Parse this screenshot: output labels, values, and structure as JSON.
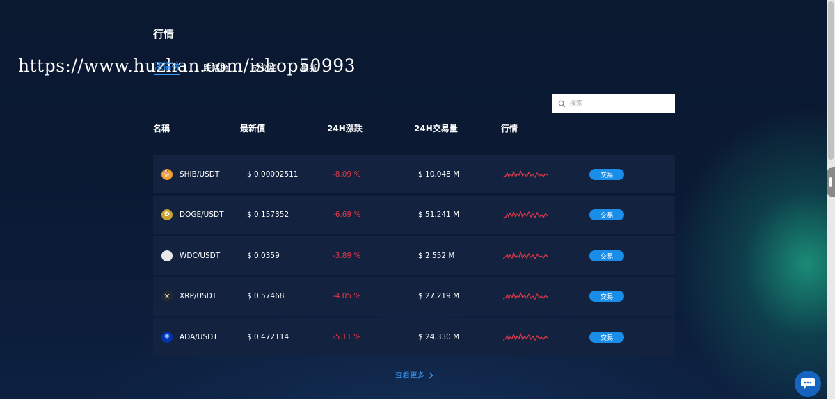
{
  "section": {
    "title": "行情"
  },
  "tabs": [
    {
      "label": "漲幅榜",
      "active": true
    },
    {
      "label": "跌幅榜",
      "active": false
    },
    {
      "label": "成交額",
      "active": false
    },
    {
      "label": "最新",
      "active": false
    }
  ],
  "watermark": "https://www.huzhan.com/ishop50993",
  "search": {
    "placeholder": "搜索",
    "icon": "search-icon"
  },
  "columns": {
    "name": "名稱",
    "price": "最新價",
    "change": "24H漲跌",
    "volume": "24H交易量",
    "trend": "行情"
  },
  "rows": [
    {
      "pair": "SHIB/USDT",
      "price": "$ 0.00002511",
      "change": "-8.09 %",
      "volume": "$ 10.048 M",
      "action": "交易",
      "icon": "shib-icon",
      "icon_color": "#f0a030"
    },
    {
      "pair": "DOGE/USDT",
      "price": "$ 0.157352",
      "change": "-6.69 %",
      "volume": "$ 51.241 M",
      "action": "交易",
      "icon": "doge-icon",
      "icon_color": "#c9a232"
    },
    {
      "pair": "WDC/USDT",
      "price": "$ 0.0359",
      "change": "-3.89 %",
      "volume": "$ 2.552 M",
      "action": "交易",
      "icon": "wdc-icon",
      "icon_color": "#e8e8e8"
    },
    {
      "pair": "XRP/USDT",
      "price": "$ 0.57468",
      "change": "-4.05 %",
      "volume": "$ 27.219 M",
      "action": "交易",
      "icon": "xrp-icon",
      "icon_color": "#23292f"
    },
    {
      "pair": "ADA/USDT",
      "price": "$ 0.472114",
      "change": "-5.11 %",
      "volume": "$ 24.330 M",
      "action": "交易",
      "icon": "ada-icon",
      "icon_color": "#0033ad"
    }
  ],
  "colors": {
    "negative": "#e03a4a",
    "accent": "#1a8de8",
    "link": "#3aa0ff",
    "row_bg": "#13223f"
  },
  "view_more": {
    "label": "查看更多"
  },
  "chat": {
    "icon": "chat-bubble-icon"
  }
}
